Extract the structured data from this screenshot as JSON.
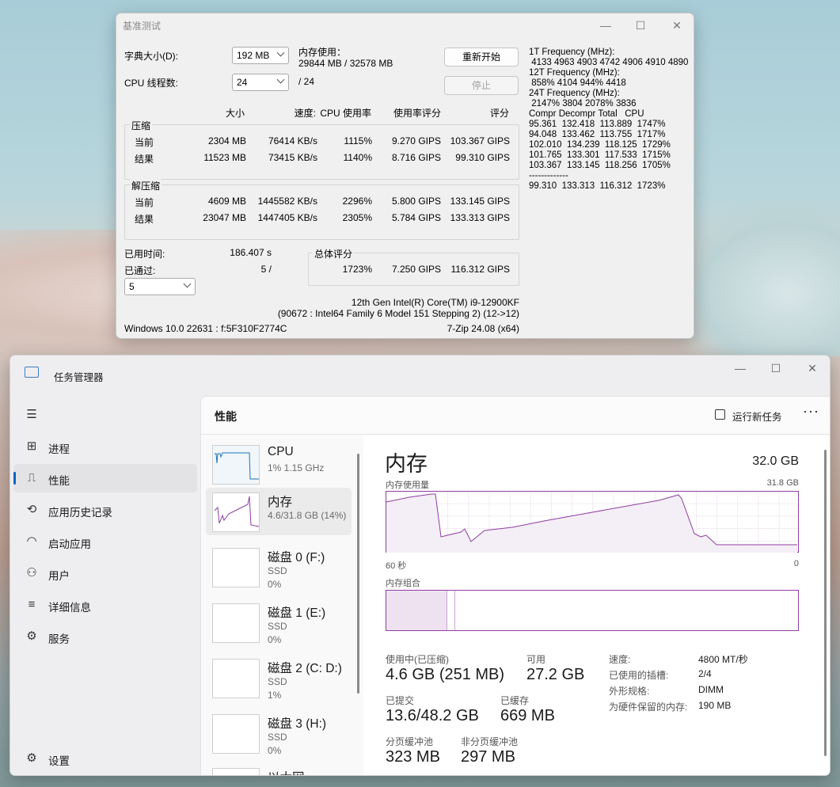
{
  "zip": {
    "title": "基准测试",
    "dict_label": "字典大小(D):",
    "dict_value": "192 MB",
    "threads_label": "CPU 线程数:",
    "threads_value": "24",
    "threads_total": "/ 24",
    "mem_label": "内存使用：",
    "mem_value": "29844 MB / 32578 MB",
    "restart_btn": "重新开始",
    "stop_btn": "停止",
    "col_size": "大小",
    "col_speed": "速度:",
    "col_cpu": "CPU 使用率",
    "col_rating_usage": "使用率评分",
    "col_rating": "评分",
    "compress_label": "压缩",
    "decompress_label": "解压缩",
    "rows": {
      "c_cur": {
        "label": "当前",
        "size": "2304 MB",
        "speed": "76414 KB/s",
        "cpu": "1115%",
        "ru": "9.270 GIPS",
        "rating": "103.367 GIPS"
      },
      "c_res": {
        "label": "结果",
        "size": "11523 MB",
        "speed": "73415 KB/s",
        "cpu": "1140%",
        "ru": "8.716 GIPS",
        "rating": "99.310 GIPS"
      },
      "d_cur": {
        "label": "当前",
        "size": "4609 MB",
        "speed": "1445582 KB/s",
        "cpu": "2296%",
        "ru": "5.800 GIPS",
        "rating": "133.145 GIPS"
      },
      "d_res": {
        "label": "结果",
        "size": "23047 MB",
        "speed": "1447405 KB/s",
        "cpu": "2305%",
        "ru": "5.784 GIPS",
        "rating": "133.313 GIPS"
      }
    },
    "elapsed_label": "已用时间:",
    "elapsed_value": "186.407 s",
    "passed_label": "已通过:",
    "passed_value": "5 /",
    "passes_select": "5",
    "total_label": "总体评分",
    "total_cpu": "1723%",
    "total_ru": "7.250 GIPS",
    "total_rating": "116.312 GIPS",
    "cpu_name": "12th Gen Intel(R) Core(TM) i9-12900KF",
    "cpu_detail": "(90672 : Intel64 Family 6 Model 151 Stepping 2) (12->12)",
    "os": "Windows 10.0 22631 : f:5F310F2774C",
    "version": "7-Zip 24.08 (x64)",
    "right_panel": "1T Frequency (MHz):\n 4133 4963 4903 4742 4906 4910 4890\n12T Frequency (MHz):\n 858% 4104 944% 4418\n24T Frequency (MHz):\n 2147% 3804 2078% 3836\nCompr Decompr Total   CPU\n95.361  132.418  113.889  1747%\n94.048  133.462  113.755  1717%\n102.010  134.239  118.125  1729%\n101.765  133.301  117.533  1715%\n103.367  133.145  118.256  1705%\n-------------\n99.310  133.313  116.312  1723%"
  },
  "tm": {
    "app_title": "任务管理器",
    "nav": [
      {
        "label": "进程",
        "icon": "processes-icon"
      },
      {
        "label": "性能",
        "icon": "performance-icon"
      },
      {
        "label": "应用历史记录",
        "icon": "app-history-icon"
      },
      {
        "label": "启动应用",
        "icon": "startup-apps-icon"
      },
      {
        "label": "用户",
        "icon": "users-icon"
      },
      {
        "label": "详细信息",
        "icon": "details-icon"
      },
      {
        "label": "服务",
        "icon": "services-icon"
      }
    ],
    "settings_label": "设置",
    "page_title": "性能",
    "run_task": "运行新任务",
    "more": "···",
    "devices": [
      {
        "name": "CPU",
        "sub1": "1% 1.15 GHz",
        "sub2": ""
      },
      {
        "name": "内存",
        "sub1": "4.6/31.8 GB (14%)",
        "sub2": ""
      },
      {
        "name": "磁盘 0 (F:)",
        "sub1": "SSD",
        "sub2": "0%"
      },
      {
        "name": "磁盘 1 (E:)",
        "sub1": "SSD",
        "sub2": "0%"
      },
      {
        "name": "磁盘 2 (C: D:)",
        "sub1": "SSD",
        "sub2": "1%"
      },
      {
        "name": "磁盘 3 (H:)",
        "sub1": "SSD",
        "sub2": "0%"
      },
      {
        "name": "以太网",
        "sub1": "",
        "sub2": ""
      }
    ],
    "detail": {
      "title": "内存",
      "total": "32.0 GB",
      "usage_label": "内存使用量",
      "usage_max": "31.8 GB",
      "axis_left": "60 秒",
      "axis_right": "0",
      "composition_label": "内存组合",
      "in_use_label": "使用中(已压缩)",
      "in_use_value": "4.6 GB (251 MB)",
      "available_label": "可用",
      "available_value": "27.2 GB",
      "committed_label": "已提交",
      "committed_value": "13.6/48.2 GB",
      "cached_label": "已缓存",
      "cached_value": "669 MB",
      "paged_label": "分页缓冲池",
      "paged_value": "323 MB",
      "nonpaged_label": "非分页缓冲池",
      "nonpaged_value": "297 MB",
      "speed_label": "速度:",
      "speed_value": "4800 MT/秒",
      "slots_label": "已使用的插槽:",
      "slots_value": "2/4",
      "form_label": "外形规格:",
      "form_value": "DIMM",
      "reserved_label": "为硬件保留的内存:",
      "reserved_value": "190 MB"
    },
    "accent": "#8e3ea0"
  }
}
